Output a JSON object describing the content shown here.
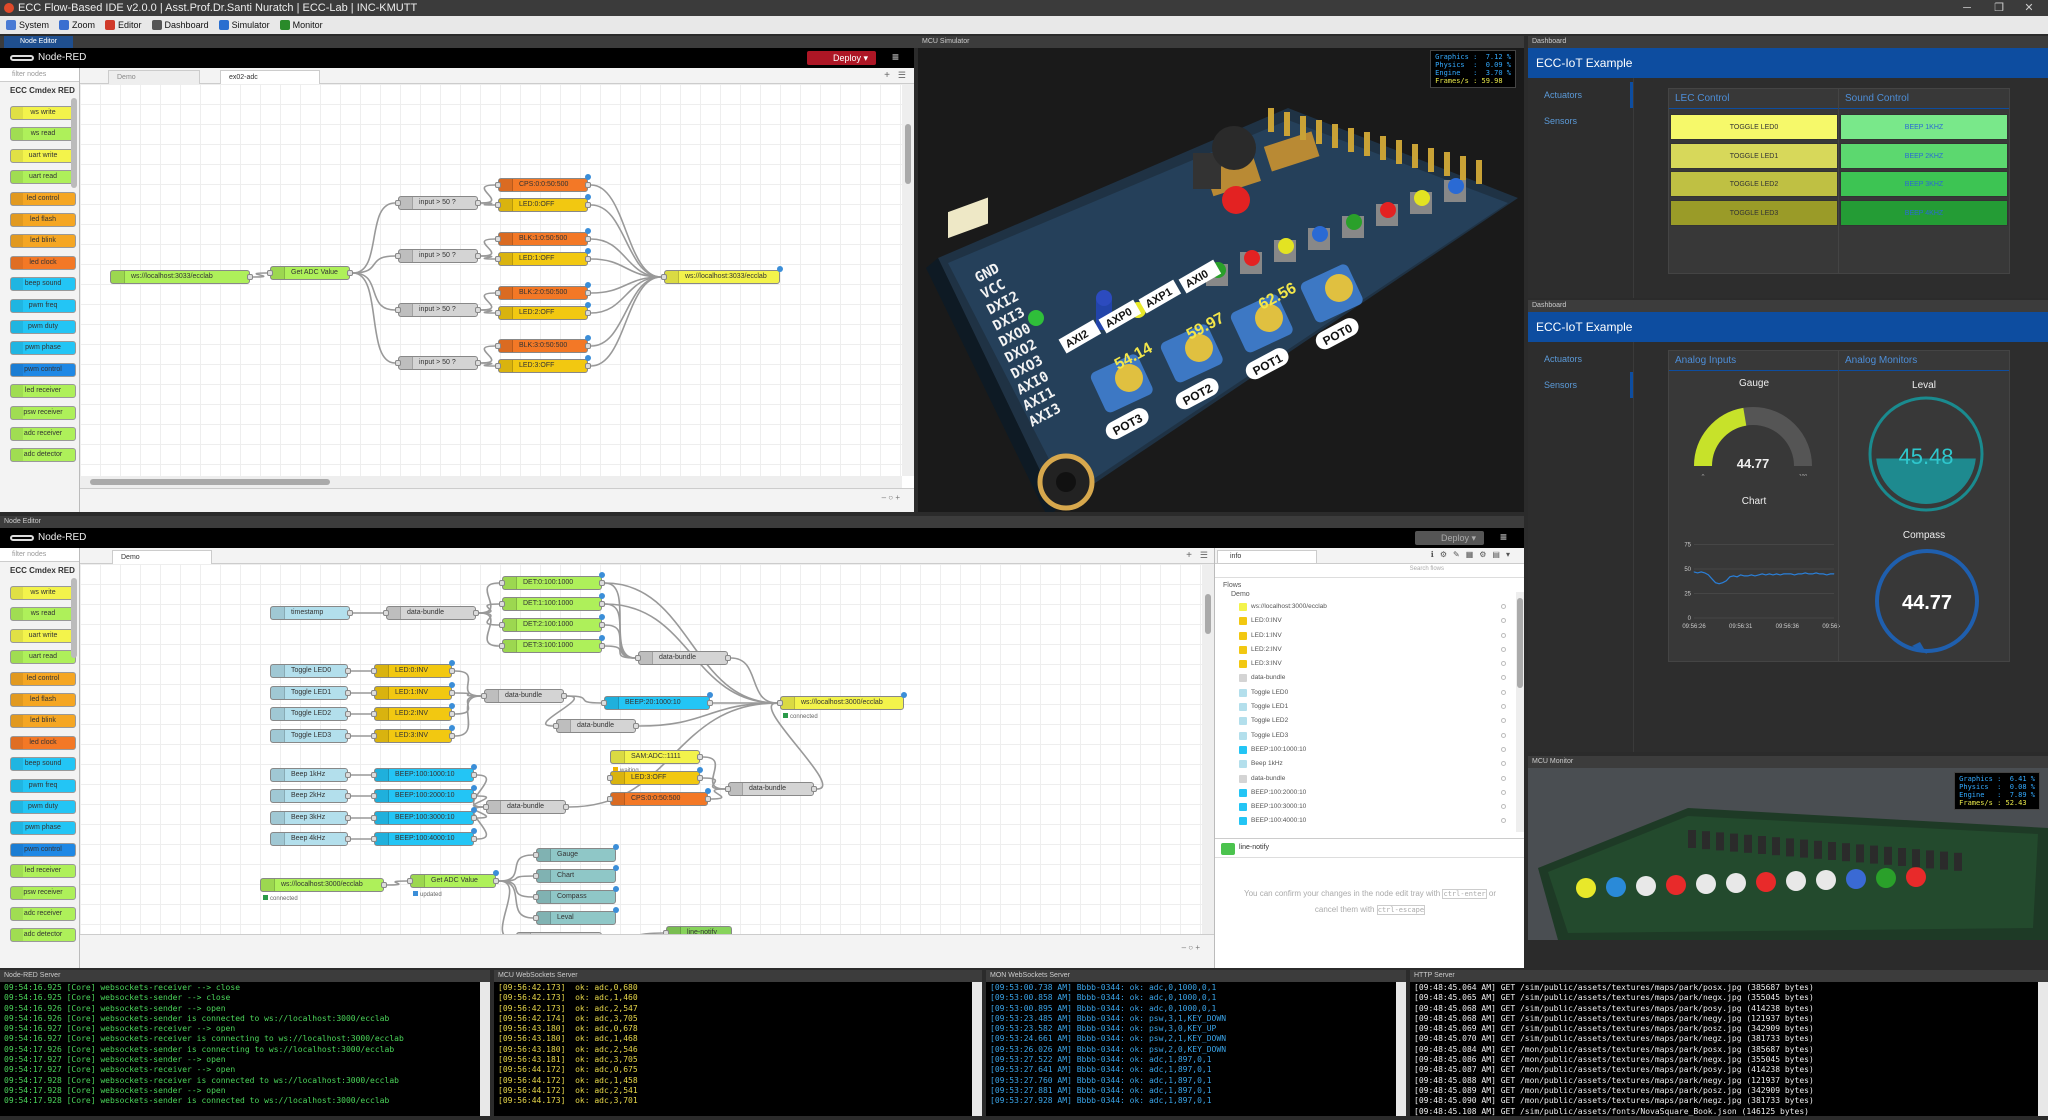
{
  "window": {
    "title": "ECC Flow-Based IDE v2.0.0 | Asst.Prof.Dr.Santi Nuratch | ECC-Lab | INC-KMUTT",
    "minimize": "─",
    "maximize": "❐",
    "close": "✕"
  },
  "menu": [
    {
      "label": "System",
      "color": "#4a7bd4"
    },
    {
      "label": "Zoom",
      "color": "#3a6fd0"
    },
    {
      "label": "Editor",
      "color": "#d03a2a"
    },
    {
      "label": "Dashboard",
      "color": "#555"
    },
    {
      "label": "Simulator",
      "color": "#2a6fd0"
    },
    {
      "label": "Monitor",
      "color": "#2a8a2a"
    }
  ],
  "panels": {
    "editor1": "Node Editor",
    "mcu_sim": "MCU Simulator",
    "dash1": "Dashboard",
    "dash2": "Dashboard",
    "editor2": "Node Editor",
    "mcu_mon": "MCU Monitor"
  },
  "node_red": {
    "brand": "Node-RED",
    "deploy": "Deploy",
    "filter": "filter nodes",
    "category": "ECC Cmdex RED"
  },
  "palette": [
    {
      "label": "ws write",
      "color": "#f3f34b"
    },
    {
      "label": "ws read",
      "color": "#aef05a"
    },
    {
      "label": "uart write",
      "color": "#f3f34b"
    },
    {
      "label": "uart read",
      "color": "#aef05a"
    },
    {
      "label": "led control",
      "color": "#f5a623"
    },
    {
      "label": "led flash",
      "color": "#f5a623"
    },
    {
      "label": "led blink",
      "color": "#f5a623"
    },
    {
      "label": "led clock",
      "color": "#f37826"
    },
    {
      "label": "beep sound",
      "color": "#23c5f5"
    },
    {
      "label": "pwm freq",
      "color": "#23c5f5"
    },
    {
      "label": "pwm duty",
      "color": "#23c5f5"
    },
    {
      "label": "pwm phase",
      "color": "#23c5f5"
    },
    {
      "label": "pwm control",
      "color": "#1e88e5"
    },
    {
      "label": "led receiver",
      "color": "#aef05a"
    },
    {
      "label": "psw receiver",
      "color": "#aef05a"
    },
    {
      "label": "adc receiver",
      "color": "#aef05a"
    },
    {
      "label": "adc detector",
      "color": "#aef05a"
    }
  ],
  "editor1": {
    "tabs": [
      "Demo",
      "ex02-adc"
    ],
    "nodes": [
      {
        "label": "ws://localhost:3033/ecclab",
        "color": "#aef05a"
      },
      {
        "label": "Get ADC Value",
        "color": "#aef05a"
      },
      {
        "label": "input > 50 ?",
        "color": "#d4d4d4"
      },
      {
        "label": "input > 50 ?",
        "color": "#d4d4d4"
      },
      {
        "label": "input > 50 ?",
        "color": "#d4d4d4"
      },
      {
        "label": "input > 50 ?",
        "color": "#d4d4d4"
      },
      {
        "label": "CPS:0:0:50:500",
        "color": "#f37826"
      },
      {
        "label": "LED:0:OFF",
        "color": "#f2c811"
      },
      {
        "label": "BLK:1:0:50:500",
        "color": "#f37826"
      },
      {
        "label": "LED:1:OFF",
        "color": "#f2c811"
      },
      {
        "label": "BLK:2:0:50:500",
        "color": "#f37826"
      },
      {
        "label": "LED:2:OFF",
        "color": "#f2c811"
      },
      {
        "label": "BLK:3:0:50:500",
        "color": "#f37826"
      },
      {
        "label": "LED:3:OFF",
        "color": "#f2c811"
      },
      {
        "label": "ws://localhost:3033/ecclab",
        "color": "#f3f34b"
      }
    ]
  },
  "editor2": {
    "tabs": [
      "Demo"
    ],
    "info_tab": "info",
    "search": "Search flows",
    "flows_label": "Flows",
    "flow_name": "Demo",
    "nodes": [
      {
        "label": "timestamp",
        "color": "#b3dfec"
      },
      {
        "label": "data-bundle",
        "color": "#d4d4d4"
      },
      {
        "label": "DET:0:100:1000",
        "color": "#aef05a"
      },
      {
        "label": "DET:1:100:1000",
        "color": "#aef05a"
      },
      {
        "label": "DET:2:100:1000",
        "color": "#aef05a"
      },
      {
        "label": "DET:3:100:1000",
        "color": "#aef05a"
      },
      {
        "label": "data-bundle",
        "color": "#d4d4d4"
      },
      {
        "label": "Toggle LED0",
        "color": "#b3dfec"
      },
      {
        "label": "Toggle LED1",
        "color": "#b3dfec"
      },
      {
        "label": "Toggle LED2",
        "color": "#b3dfec"
      },
      {
        "label": "Toggle LED3",
        "color": "#b3dfec"
      },
      {
        "label": "LED:0:INV",
        "color": "#f2c811"
      },
      {
        "label": "LED:1:INV",
        "color": "#f2c811"
      },
      {
        "label": "LED:2:INV",
        "color": "#f2c811"
      },
      {
        "label": "LED:3:INV",
        "color": "#f2c811"
      },
      {
        "label": "data-bundle",
        "color": "#d4d4d4"
      },
      {
        "label": "BEEP:20:1000:10",
        "color": "#23c5f5"
      },
      {
        "label": "data-bundle",
        "color": "#d4d4d4"
      },
      {
        "label": "ws://localhost:3000/ecclab",
        "color": "#f3f34b"
      },
      {
        "label": "SAM:ADC::1111",
        "color": "#f3f34b"
      },
      {
        "label": "LED:3:OFF",
        "color": "#f2c811"
      },
      {
        "label": "CPS:0:0:50:500",
        "color": "#f37826"
      },
      {
        "label": "data-bundle",
        "color": "#d4d4d4"
      },
      {
        "label": "Beep 1kHz",
        "color": "#b3dfec"
      },
      {
        "label": "Beep 2kHz",
        "color": "#b3dfec"
      },
      {
        "label": "Beep 3kHz",
        "color": "#b3dfec"
      },
      {
        "label": "Beep 4kHz",
        "color": "#b3dfec"
      },
      {
        "label": "BEEP:100:1000:10",
        "color": "#23c5f5"
      },
      {
        "label": "BEEP:100:2000:10",
        "color": "#23c5f5"
      },
      {
        "label": "BEEP:100:3000:10",
        "color": "#23c5f5"
      },
      {
        "label": "BEEP:100:4000:10",
        "color": "#23c5f5"
      },
      {
        "label": "data-bundle",
        "color": "#d4d4d4"
      },
      {
        "label": "ws://localhost:3000/ecclab",
        "color": "#aef05a"
      },
      {
        "label": "Get ADC Value",
        "color": "#aef05a"
      },
      {
        "label": "Gauge",
        "color": "#8fc7c7"
      },
      {
        "label": "Chart",
        "color": "#8fc7c7"
      },
      {
        "label": "Compass",
        "color": "#8fc7c7"
      },
      {
        "label": "Leval",
        "color": "#8fc7c7"
      },
      {
        "label": "input > 90 ?",
        "color": "#d4d4d4"
      },
      {
        "label": "line-notify",
        "color": "#87d35b"
      }
    ],
    "status": {
      "connected": "connected",
      "waiting": "waiting",
      "updated": "updated",
      "pending": "pending"
    },
    "info_list": [
      "ws://localhost:3000/ecclab",
      "LED:0:INV",
      "LED:1:INV",
      "LED:2:INV",
      "LED:3:INV",
      "data-bundle",
      "Toggle LED0",
      "Toggle LED1",
      "Toggle LED2",
      "Toggle LED3",
      "BEEP:100:1000:10",
      "Beep 1kHz",
      "data-bundle",
      "BEEP:100:2000:10",
      "BEEP:100:3000:10",
      "BEEP:100:4000:10"
    ],
    "notify_title": "line-notify",
    "help_text": "You can confirm your changes in the node edit tray with",
    "help_key1": "ctrl-enter",
    "help_or": "or",
    "help_text2": "cancel them with",
    "help_key2": "ctrl-escape"
  },
  "sim_hud": {
    "lines": [
      "Graphics :  7.12 %",
      "Physics  :  0.09 %",
      "Engine   :  3.70 %",
      "Frames/s : 59.98"
    ]
  },
  "mon_hud": {
    "lines": [
      "Graphics :  6.41 %",
      "Physics  :  0.08 %",
      "Engine   :  7.89 %",
      "Frames/s : 52.43"
    ]
  },
  "board": {
    "pins": [
      "GND",
      "VCC",
      "DXI2",
      "DXI3",
      "DXO0",
      "DXO2",
      "DXO3",
      "AXI0",
      "AXI1",
      "AXI3"
    ],
    "pots": [
      "POT3",
      "POT2",
      "POT1",
      "POT0"
    ],
    "pot_values": [
      "54.14",
      "59.97",
      "62.56"
    ],
    "axi_labels": [
      "AXI2",
      "AXP0",
      "AXP1",
      "AXI0"
    ]
  },
  "dash1": {
    "title": "ECC-IoT Example",
    "side": [
      "Actuators",
      "Sensors"
    ],
    "card1": "LEC Control",
    "card2": "Sound Control",
    "leds": [
      {
        "label": "TOGGLE LED0",
        "color": "#f6f96a"
      },
      {
        "label": "TOGGLE LED1",
        "color": "#d7d85a"
      },
      {
        "label": "TOGGLE LED2",
        "color": "#bfc043"
      },
      {
        "label": "TOGGLE LED3",
        "color": "#9a9b28"
      }
    ],
    "beeps": [
      {
        "label": "BEEP 1KHZ",
        "color": "#79e88a"
      },
      {
        "label": "BEEP 2KHZ",
        "color": "#5cd86f"
      },
      {
        "label": "BEEP 3KHZ",
        "color": "#3dc453"
      },
      {
        "label": "BEEP 4KHZ",
        "color": "#249c35"
      }
    ]
  },
  "dash2": {
    "title": "ECC-IoT Example",
    "side": [
      "Actuators",
      "Sensors"
    ],
    "card1": "Analog Inputs",
    "card2": "Analog Monitors",
    "gauge": {
      "title": "Gauge",
      "value": "44.77",
      "min": "0",
      "max": "100",
      "fraction": 0.4477
    },
    "level": {
      "title": "Leval",
      "value": "45.48",
      "fraction": 0.4548
    },
    "compass": {
      "title": "Compass",
      "value": "44.77"
    }
  },
  "chart_data": {
    "type": "line",
    "title": "Chart",
    "categories": [
      "09:56:26",
      "09:56:31",
      "09:56:36",
      "09:56:45"
    ],
    "yticks": [
      "0",
      "25",
      "50",
      "75"
    ],
    "ylim": [
      0,
      100
    ],
    "x": [
      0,
      1,
      2,
      3,
      4,
      5,
      6,
      7,
      8,
      9,
      10,
      11,
      12,
      13,
      14,
      15,
      16,
      17,
      18,
      19,
      20,
      21,
      22,
      23,
      24,
      25,
      26,
      27,
      28,
      29,
      30,
      31,
      32,
      33,
      34,
      35,
      36,
      37,
      38,
      39
    ],
    "values": [
      47,
      46,
      47,
      46,
      44,
      40,
      36,
      35,
      36,
      38,
      42,
      43,
      42,
      44,
      43,
      43,
      44,
      43,
      44,
      45,
      44,
      45,
      44,
      45,
      44,
      45,
      45,
      45,
      44,
      45,
      45,
      46,
      45,
      45,
      46,
      45,
      45,
      44,
      45,
      45
    ]
  },
  "consoles": [
    {
      "title": "Node-RED Server",
      "color": "#4bd45a",
      "lines": [
        "09:54:16.925 [Core] websockets-receiver --> close",
        "09:54:16.925 [Core] websockets-sender --> close",
        "09:54:16.926 [Core] websockets-sender --> open",
        "09:54:16.926 [Core] websockets-sender is connected to ws://localhost:3000/ecclab",
        "09:54:16.927 [Core] websockets-receiver --> open",
        "09:54:16.927 [Core] websockets-receiver is connecting to ws://localhost:3000/ecclab",
        "09:54:17.926 [Core] websockets-sender is connecting to ws://localhost:3000/ecclab",
        "09:54:17.927 [Core] websockets-sender --> open",
        "09:54:17.927 [Core] websockets-receiver --> open",
        "09:54:17.928 [Core] websockets-receiver is connected to ws://localhost:3000/ecclab",
        "09:54:17.928 [Core] websockets-sender --> open",
        "09:54:17.928 [Core] websockets-sender is connected to ws://localhost:3000/ecclab"
      ]
    },
    {
      "title": "MCU WebSockets Server",
      "color": "#e8d84a",
      "lines": [
        "[09:56:42.173]  ok: adc,0,680",
        "[09:56:42.173]  ok: adc,1,460",
        "[09:56:42.173]  ok: adc,2,547",
        "[09:56:42.174]  ok: adc,3,705",
        "[09:56:43.180]  ok: adc,0,678",
        "[09:56:43.180]  ok: adc,1,468",
        "[09:56:43.180]  ok: adc,2,546",
        "[09:56:43.181]  ok: adc,3,705",
        "[09:56:44.172]  ok: adc,0,675",
        "[09:56:44.172]  ok: adc,1,458",
        "[09:56:44.172]  ok: adc,2,541",
        "[09:56:44.173]  ok: adc,3,701"
      ]
    },
    {
      "title": "MON WebSockets Server",
      "color": "#3aa4e8",
      "lines": [
        "[09:53:00.738 AM] Bbbb-0344: ok: adc,0,1000,0,1",
        "[09:53:00.858 AM] Bbbb-0344: ok: adc,0,1000,0,1",
        "[09:53:00.895 AM] Bbbb-0344: ok: adc,0,1000,0,1",
        "[09:53:23.485 AM] Bbbb-0344: ok: psw,3,1,KEY_DOWN",
        "[09:53:23.582 AM] Bbbb-0344: ok: psw,3,0,KEY_UP",
        "[09:53:24.661 AM] Bbbb-0344: ok: psw,2,1,KEY_DOWN",
        "[09:53:26.026 AM] Bbbb-0344: ok: psw,2,0,KEY_DOWN",
        "[09:53:27.522 AM] Bbbb-0344: ok: adc,1,897,0,1",
        "[09:53:27.641 AM] Bbbb-0344: ok: adc,1,897,0,1",
        "[09:53:27.760 AM] Bbbb-0344: ok: adc,1,897,0,1",
        "[09:53:27.881 AM] Bbbb-0344: ok: adc,1,897,0,1",
        "[09:53:27.928 AM] Bbbb-0344: ok: adc,1,897,0,1"
      ]
    },
    {
      "title": "HTTP Server",
      "color": "#eeeeee",
      "lines": [
        "[09:48:45.064 AM] GET /sim/public/assets/textures/maps/park/posx.jpg (385687 bytes)",
        "[09:48:45.065 AM] GET /sim/public/assets/textures/maps/park/negx.jpg (355045 bytes)",
        "[09:48:45.068 AM] GET /sim/public/assets/textures/maps/park/posy.jpg (414238 bytes)",
        "[09:48:45.068 AM] GET /sim/public/assets/textures/maps/park/negy.jpg (121937 bytes)",
        "[09:48:45.069 AM] GET /sim/public/assets/textures/maps/park/posz.jpg (342909 bytes)",
        "[09:48:45.070 AM] GET /sim/public/assets/textures/maps/park/negz.jpg (381733 bytes)",
        "[09:48:45.084 AM] GET /mon/public/assets/textures/maps/park/posx.jpg (385687 bytes)",
        "[09:48:45.086 AM] GET /mon/public/assets/textures/maps/park/negx.jpg (355045 bytes)",
        "[09:48:45.087 AM] GET /mon/public/assets/textures/maps/park/posy.jpg (414238 bytes)",
        "[09:48:45.088 AM] GET /mon/public/assets/textures/maps/park/negy.jpg (121937 bytes)",
        "[09:48:45.089 AM] GET /mon/public/assets/textures/maps/park/posz.jpg (342909 bytes)",
        "[09:48:45.090 AM] GET /mon/public/assets/textures/maps/park/negz.jpg (381733 bytes)",
        "[09:48:45.108 AM] GET /sim/public/assets/fonts/NovaSquare_Book.json (146125 bytes)"
      ]
    }
  ]
}
